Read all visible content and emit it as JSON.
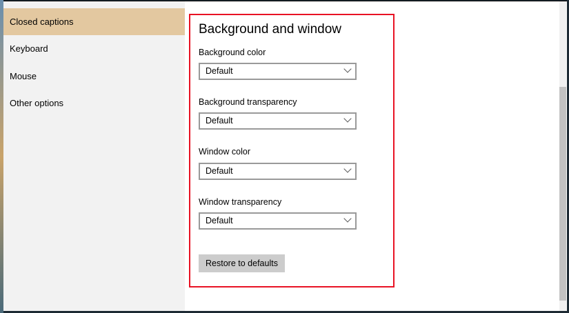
{
  "sidebar": {
    "items": [
      {
        "label": "Closed captions",
        "selected": true
      },
      {
        "label": "Keyboard"
      },
      {
        "label": "Mouse"
      },
      {
        "label": "Other options"
      }
    ]
  },
  "main": {
    "section_title": "Background and window",
    "fields": [
      {
        "label": "Background color",
        "value": "Default"
      },
      {
        "label": "Background transparency",
        "value": "Default"
      },
      {
        "label": "Window color",
        "value": "Default"
      },
      {
        "label": "Window transparency",
        "value": "Default"
      }
    ],
    "restore_label": "Restore to defaults"
  },
  "colors": {
    "selected": "#e3c8a0",
    "highlight": "#e81123"
  }
}
